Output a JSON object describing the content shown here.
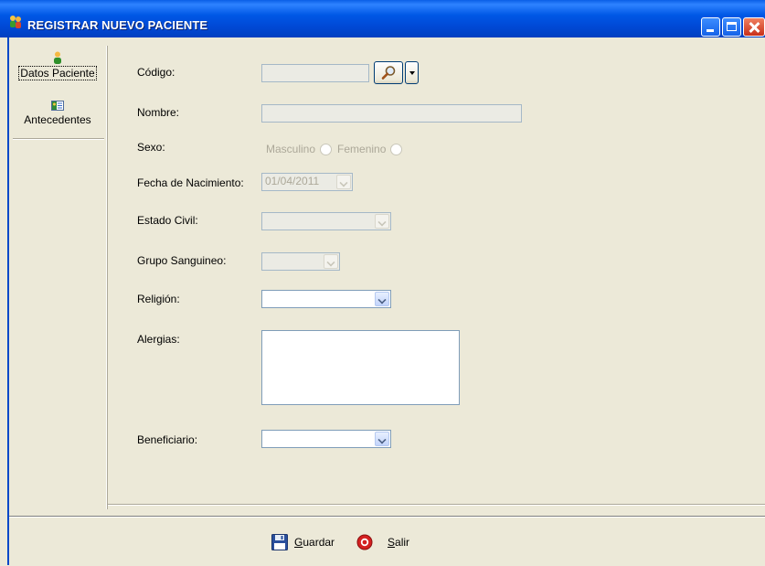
{
  "window": {
    "title": "REGISTRAR NUEVO PACIENTE"
  },
  "sidebar": {
    "items": [
      {
        "label": "Datos Paciente",
        "icon": "person-icon",
        "selected": true
      },
      {
        "label": "Antecedentes",
        "icon": "card-icon",
        "selected": false
      }
    ]
  },
  "form": {
    "codigo": {
      "label": "Código:",
      "value": "",
      "enabled": false
    },
    "nombre": {
      "label": "Nombre:",
      "value": "",
      "enabled": false
    },
    "sexo": {
      "label": "Sexo:",
      "options": [
        "Masculino",
        "Femenino"
      ],
      "enabled": false
    },
    "fecha_nacimiento": {
      "label": "Fecha de Nacimiento:",
      "value": "01/04/2011",
      "enabled": false
    },
    "estado_civil": {
      "label": "Estado Civil:",
      "value": "",
      "enabled": false
    },
    "grupo_sanguineo": {
      "label": "Grupo Sanguineo:",
      "value": "",
      "enabled": false
    },
    "religion": {
      "label": "Religión:",
      "value": "",
      "enabled": true
    },
    "alergias": {
      "label": "Alergias:",
      "value": "",
      "enabled": true
    },
    "beneficiario": {
      "label": "Beneficiario:",
      "value": "",
      "enabled": true
    }
  },
  "actions": {
    "guardar": {
      "accel": "G",
      "rest": "uardar",
      "icon": "floppy-disk-icon"
    },
    "salir": {
      "accel": "S",
      "rest": "alir",
      "icon": "exit-icon"
    }
  },
  "colors": {
    "titlebar": "#0058e6",
    "window_bg": "#ece9d8",
    "input_border": "#7f9db9",
    "disabled_text": "#aca899"
  }
}
